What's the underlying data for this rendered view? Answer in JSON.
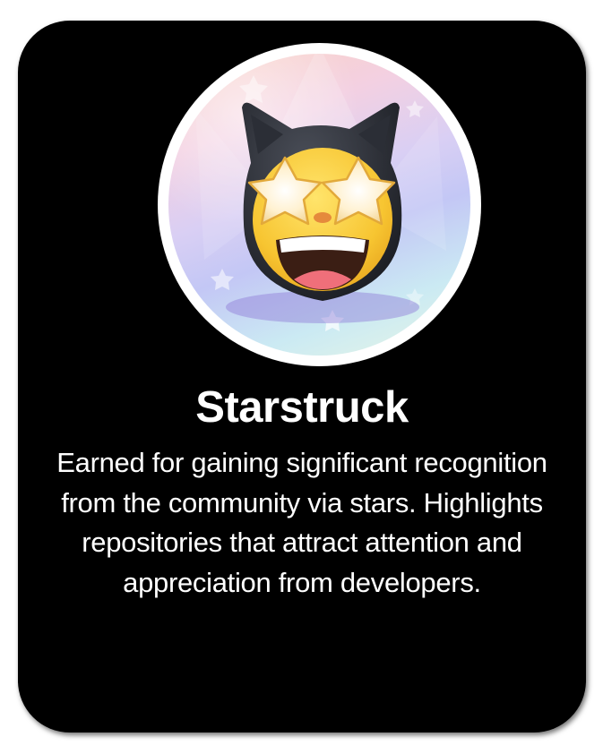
{
  "badge": {
    "icon": "starstruck-cat-icon",
    "title": "Starstruck",
    "description": "Earned for gaining significant recognition from the community via stars. Highlights repositories that attract attention and appreciation from developers."
  },
  "colors": {
    "card_background": "#000000",
    "text": "#ffffff",
    "ring": "#ffffff"
  }
}
